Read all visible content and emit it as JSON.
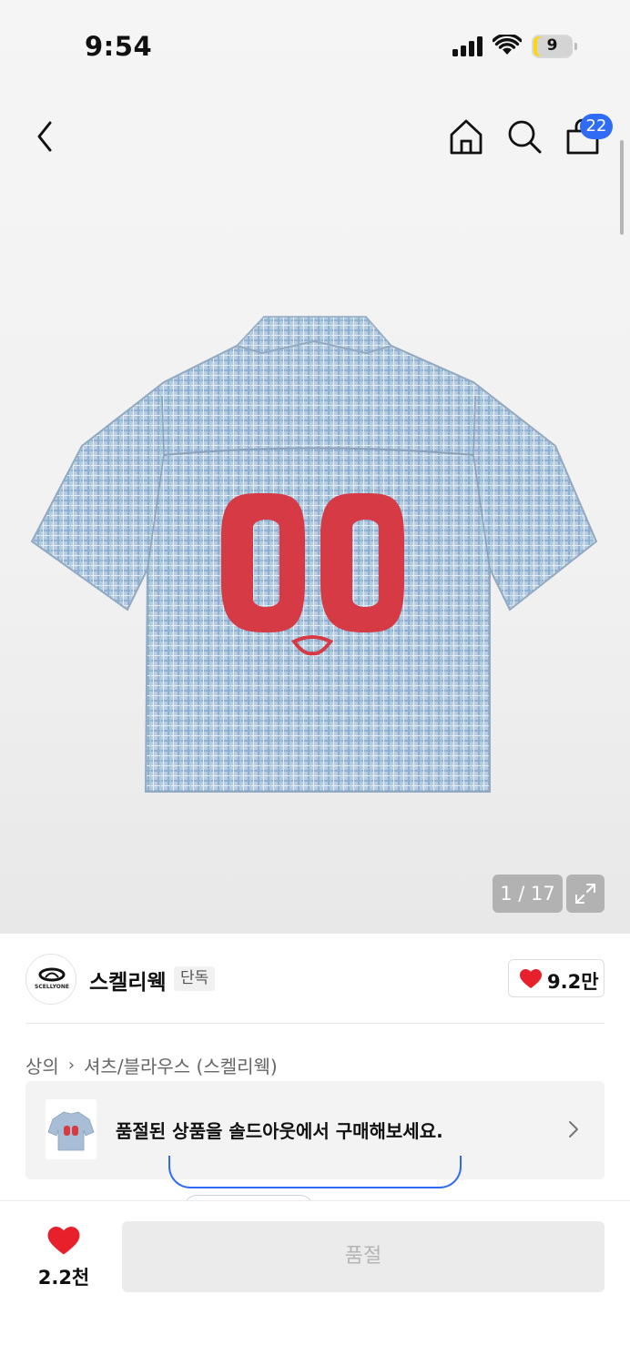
{
  "status_bar": {
    "time": "9:54",
    "battery_level": "9"
  },
  "nav": {
    "cart_count": "22"
  },
  "gallery": {
    "counter": "1 / 17"
  },
  "brand": {
    "name": "스켈리웩",
    "tag": "단독",
    "logo_text": "SCELLYONE",
    "likes": "9.2만"
  },
  "breadcrumb": {
    "category": "상의",
    "subcategory": "셔츠/블라우스 (스켈리웩)"
  },
  "soldout_card": {
    "text": "품절된 상품을 솔드아웃에서 구매해보세요."
  },
  "bottom": {
    "fav_count": "2.2천",
    "button_label": "품절"
  },
  "colors": {
    "accent": "#2f6bf5",
    "heart": "#e8202c",
    "shirt_print": "#d63a44"
  }
}
